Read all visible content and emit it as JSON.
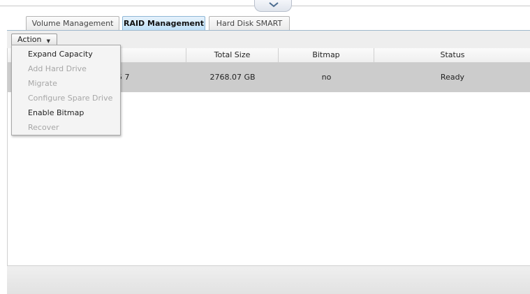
{
  "tabs": [
    {
      "label": "Volume Management",
      "active": false
    },
    {
      "label": "RAID Management",
      "active": true
    },
    {
      "label": "Hard Disk SMART",
      "active": false
    }
  ],
  "toolbar": {
    "action_label": "Action"
  },
  "action_menu": {
    "items": [
      {
        "label": "Expand Capacity",
        "enabled": true
      },
      {
        "label": "Add Hard Drive",
        "enabled": false
      },
      {
        "label": "Migrate",
        "enabled": false
      },
      {
        "label": "Configure Spare Drive",
        "enabled": false
      },
      {
        "label": "Enable Bitmap",
        "enabled": true
      },
      {
        "label": "Recover",
        "enabled": false
      }
    ]
  },
  "grid": {
    "columns": [
      "Total Size",
      "Bitmap",
      "Status"
    ],
    "rows": [
      {
        "partial": "5 7",
        "total_size": "2768.07 GB",
        "bitmap": "no",
        "status": "Ready"
      }
    ]
  },
  "colors": {
    "active_tab": "#bfe0f7",
    "selected_row": "#cccccc",
    "menu_bg": "#f4f4f4"
  }
}
